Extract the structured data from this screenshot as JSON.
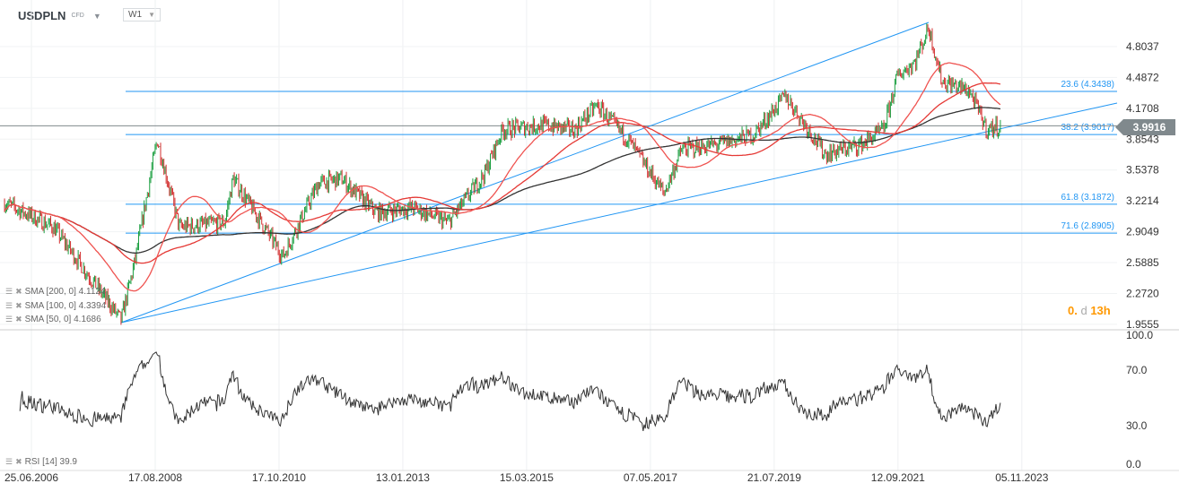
{
  "header": {
    "symbol": "USDPLN",
    "type": "CFD",
    "timeframe": "W1"
  },
  "colors": {
    "up": "#1a9e3f",
    "down": "#d32f2f",
    "sma200": "#333333",
    "sma100": "#e53935",
    "sma50": "#ef5350",
    "fib": "#2196f3",
    "trend": "#2196f3"
  },
  "price_axis": [
    "4.8037",
    "4.4872",
    "4.1708",
    "3.8543",
    "3.5378",
    "3.2214",
    "2.9049",
    "2.5885",
    "2.2720",
    "1.9555"
  ],
  "current_price": "3.9916",
  "fib_levels": [
    {
      "label": "23.6 (4.3438)",
      "value": 4.3438
    },
    {
      "label": "38.2 (3.9017)",
      "value": 3.9017
    },
    {
      "label": "61.8 (3.1872)",
      "value": 3.1872
    },
    {
      "label": "71.6 (2.8905)",
      "value": 2.8905
    }
  ],
  "indicators": [
    {
      "label": "SMA [200, 0] 4.1124"
    },
    {
      "label": "SMA [100, 0] 4.3394"
    },
    {
      "label": "SMA [50, 0] 4.1686"
    }
  ],
  "rsi": {
    "label": "RSI [14] 39.9",
    "axis": [
      "100.0",
      "70.0",
      "30.0",
      "0.0"
    ]
  },
  "countdown": {
    "prefix": "0.",
    "suffix": "d",
    "hours": "13h"
  },
  "date_axis": [
    "25.06.2006",
    "17.08.2008",
    "17.10.2010",
    "13.01.2013",
    "15.03.2015",
    "07.05.2017",
    "21.07.2019",
    "12.09.2021",
    "05.11.2023"
  ],
  "chart_data": {
    "type": "candlestick",
    "price_range": [
      1.9555,
      4.8037
    ],
    "anchors": [
      [
        2006.01,
        3.2
      ],
      [
        2006.87,
        2.95
      ],
      [
        2008.05,
        2.0
      ],
      [
        2008.29,
        2.6
      ],
      [
        2008.68,
        3.85
      ],
      [
        2009.07,
        2.95
      ],
      [
        2009.86,
        3.0
      ],
      [
        2010.01,
        3.45
      ],
      [
        2010.88,
        2.65
      ],
      [
        2011.5,
        3.4
      ],
      [
        2011.9,
        3.45
      ],
      [
        2012.52,
        3.1
      ],
      [
        2013.15,
        3.15
      ],
      [
        2013.78,
        3.0
      ],
      [
        2014.41,
        3.5
      ],
      [
        2014.72,
        3.95
      ],
      [
        2015.43,
        4.0
      ],
      [
        2015.98,
        3.95
      ],
      [
        2016.37,
        4.2
      ],
      [
        2016.92,
        3.85
      ],
      [
        2017.55,
        3.3
      ],
      [
        2017.86,
        3.75
      ],
      [
        2018.49,
        3.8
      ],
      [
        2019.12,
        3.9
      ],
      [
        2019.67,
        4.3
      ],
      [
        2020.37,
        3.7
      ],
      [
        2020.99,
        3.8
      ],
      [
        2021.39,
        3.95
      ],
      [
        2021.63,
        4.5
      ],
      [
        2021.94,
        4.65
      ],
      [
        2022.18,
        5.0
      ],
      [
        2022.41,
        4.45
      ],
      [
        2022.89,
        4.35
      ],
      [
        2023.2,
        3.95
      ],
      [
        2023.44,
        3.99
      ]
    ]
  }
}
